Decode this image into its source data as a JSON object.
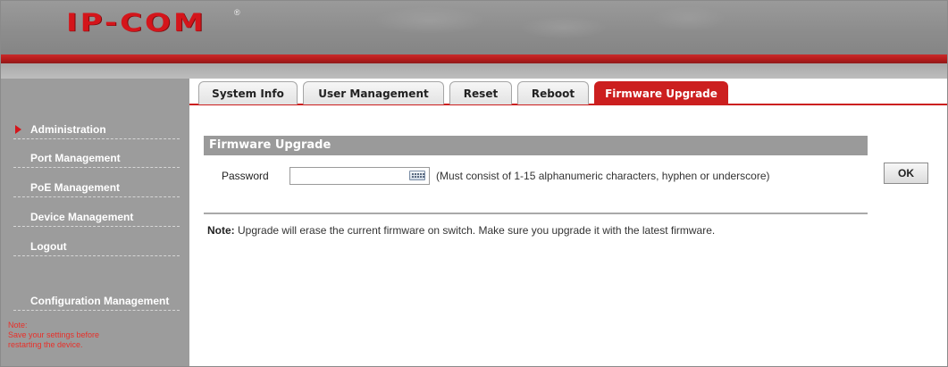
{
  "header": {
    "logo_text": "IP-COM",
    "logo_mark": "®"
  },
  "sidebar": {
    "items": [
      {
        "label": "Administration",
        "active": true
      },
      {
        "label": "Port Management"
      },
      {
        "label": "PoE Management"
      },
      {
        "label": "Device Management"
      },
      {
        "label": "Logout"
      },
      {
        "label": "Configuration Management"
      }
    ],
    "note_title": "Note:",
    "note_text_1": "Save your settings before",
    "note_text_2": "restarting the device."
  },
  "tabs": [
    {
      "label": "System Info"
    },
    {
      "label": "User Management"
    },
    {
      "label": "Reset"
    },
    {
      "label": "Reboot"
    },
    {
      "label": "Firmware Upgrade",
      "active": true
    }
  ],
  "main": {
    "section_title": "Firmware Upgrade",
    "password_label": "Password",
    "password_value": "",
    "password_hint": "(Must consist of 1-15 alphanumeric characters, hyphen or underscore)",
    "ok_label": "OK",
    "note_label": "Note:",
    "note_text": " Upgrade will erase the current firmware on switch. Make sure you upgrade it with the latest firmware."
  },
  "colors": {
    "brand_red": "#cc1f1f",
    "sidebar_grey": "#9c9c9c",
    "note_red": "#e8302a"
  },
  "icons": {
    "active_indicator": "triangle-right-icon",
    "keyboard": "keyboard-icon"
  }
}
